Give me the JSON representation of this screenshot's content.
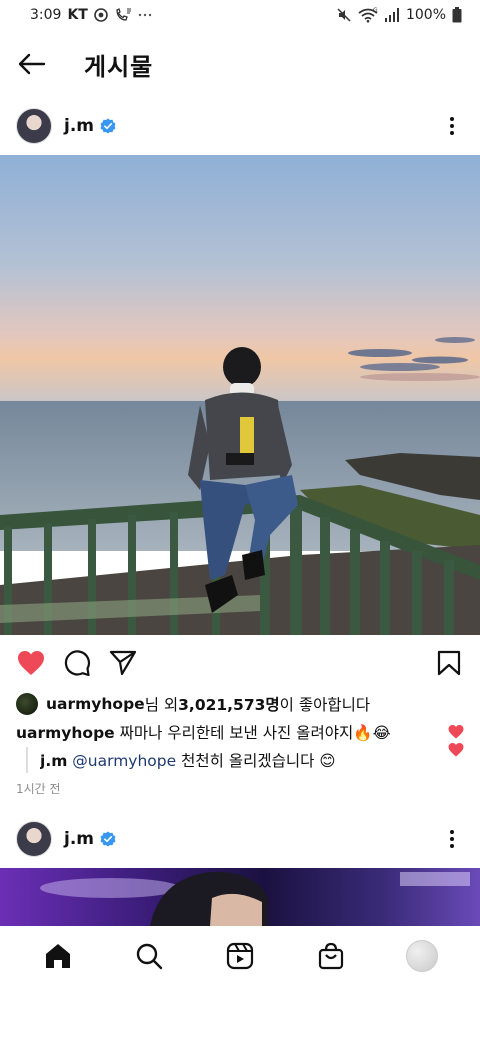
{
  "statusbar": {
    "time": "3:09",
    "carrier": "KT",
    "battery": "100%",
    "icons": [
      "kt-app-icon",
      "phone-call-icon",
      "more-dots-icon",
      "mute-icon",
      "wifi-icon",
      "signal-icon",
      "battery-icon"
    ]
  },
  "header": {
    "title": "게시물",
    "back_icon": "arrow-left-icon"
  },
  "post1": {
    "username": "j.m",
    "verified": true,
    "likes_user": "uarmyhope",
    "likes_text_mid": "님 외 ",
    "likes_count": "3,021,573명",
    "likes_text_end": "이 좋아합니다",
    "comments": [
      {
        "user": "uarmyhope",
        "text": " 짜마나 우리한테 보낸 사진 올려야지",
        "emoji": "🔥😂"
      },
      {
        "user": "j.m",
        "mention": " @uarmyhope",
        "text": " 천천히 올리겠습니다 ",
        "emoji": "😊"
      }
    ],
    "timestamp": "1시간 전"
  },
  "post2": {
    "username": "j.m",
    "verified": true
  },
  "nav": {
    "items": [
      "home-icon",
      "search-icon",
      "reels-icon",
      "shop-icon",
      "profile-avatar"
    ]
  },
  "colors": {
    "like_red": "#ed4956",
    "verified_blue": "#3897f0",
    "mention_blue": "#1f3a73",
    "muted_gray": "#8e8e8e"
  }
}
